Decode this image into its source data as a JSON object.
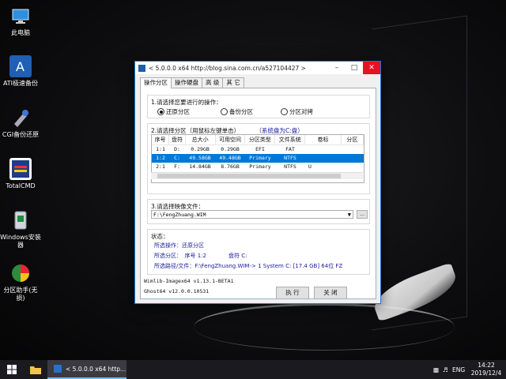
{
  "desktop": {
    "icons": [
      {
        "label": "此电脑",
        "icon": "pc-icon"
      },
      {
        "label": "ATI极速备份",
        "icon": "ati-backup-icon"
      },
      {
        "label": "CGI备份还原",
        "icon": "cgi-tools-icon"
      },
      {
        "label": "TotalCMD",
        "icon": "totalcmd-icon"
      },
      {
        "label": "Windows安装器",
        "icon": "windows-installer-icon"
      },
      {
        "label": "分区助手(无损)",
        "icon": "partition-assistant-icon"
      }
    ]
  },
  "window": {
    "title": "< 5.0.0.0 x64 http://blog.sina.com.cn/a527104427 >",
    "tabs": [
      "操作分区",
      "操作硬盘",
      "高 级",
      "其 它"
    ],
    "section1": {
      "title": "1.请选择您要进行的操作：",
      "options": [
        "还原分区",
        "备份分区",
        "分区对拷"
      ],
      "selected": "还原分区"
    },
    "section2": {
      "title": "2.请选择分区（用鼠标左键单击）",
      "hint": "（系统盘为C:盘）",
      "columns": [
        "序号",
        "盘符",
        "总大小",
        "可用空间",
        "分区类型",
        "文件系统",
        "卷标",
        "分区"
      ],
      "rows": [
        [
          "1:1",
          "D:",
          "0.29GB",
          "0.29GB",
          "EFI",
          "FAT",
          "",
          ""
        ],
        [
          "1:2",
          "C:",
          "49.58GB",
          "49.48GB",
          "Primary",
          "NTFS",
          "",
          ""
        ],
        [
          "2:1",
          "F:",
          "14.84GB",
          "8.76GB",
          "Primary",
          "NTFS",
          "U",
          ""
        ]
      ],
      "selected_row": 1
    },
    "section3": {
      "title": "3.请选择映像文件：",
      "value": "F:\\FengZhuang.WIM",
      "browse_label": "..."
    },
    "status": {
      "title": "状态：",
      "line1": "所选操作：还原分区",
      "line2": "所选分区：　序号 1:2　　　　盘符 C:",
      "line3": "所选路径/文件：F:\\FengZhuang.WIM-> 1 System C: [17.4 GB] 64位 FZ"
    },
    "footer": {
      "version1": "Wimlib-Imagex64 v1.13.1-BETA1",
      "version2": "Ghost64 v12.0.0.10531",
      "execute_label": "执 行",
      "close_label": "关 闭"
    }
  },
  "taskbar": {
    "app_title": "< 5.0.0.0 x64 http...",
    "lang": "ENG",
    "time": "14:22",
    "date": "2019/12/4"
  },
  "colors": {
    "selection": "#0078d7",
    "status_text": "#1a1a9c",
    "close_button": "#e81123"
  }
}
